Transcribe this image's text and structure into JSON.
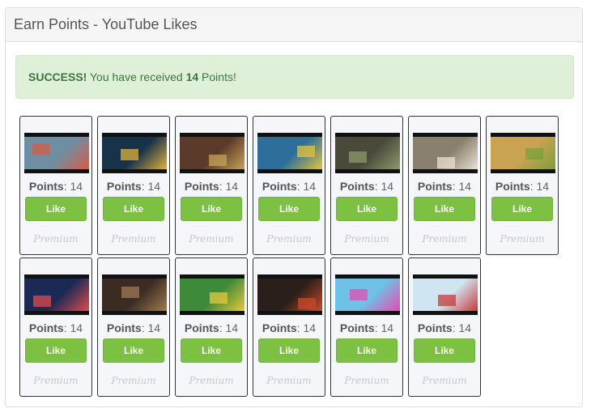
{
  "page": {
    "title": "Earn Points - YouTube Likes"
  },
  "alert": {
    "strong": "SUCCESS!",
    "text1": " You have received ",
    "amount": "14",
    "text2": " Points!"
  },
  "cards": [
    {
      "points_label": "Points",
      "points_value": ": 14",
      "like_label": "Like",
      "premium_label": "Premium",
      "thumb_bg": "#6e8fa3",
      "thumb_accent": "#d95b43"
    },
    {
      "points_label": "Points",
      "points_value": ": 14",
      "like_label": "Like",
      "premium_label": "Premium",
      "thumb_bg": "#18324a",
      "thumb_accent": "#e0b23a"
    },
    {
      "points_label": "Points",
      "points_value": ": 14",
      "like_label": "Like",
      "premium_label": "Premium",
      "thumb_bg": "#5a3a28",
      "thumb_accent": "#c8a25a"
    },
    {
      "points_label": "Points",
      "points_value": ": 14",
      "like_label": "Like",
      "premium_label": "Premium",
      "thumb_bg": "#2d6f9a",
      "thumb_accent": "#e3c43b"
    },
    {
      "points_label": "Points",
      "points_value": ": 14",
      "like_label": "Like",
      "premium_label": "Premium",
      "thumb_bg": "#4a4a3a",
      "thumb_accent": "#8a9a6a"
    },
    {
      "points_label": "Points",
      "points_value": ": 14",
      "like_label": "Like",
      "premium_label": "Premium",
      "thumb_bg": "#8a8070",
      "thumb_accent": "#e8e0d0"
    },
    {
      "points_label": "Points",
      "points_value": ": 14",
      "like_label": "Like",
      "premium_label": "Premium",
      "thumb_bg": "#c9a352",
      "thumb_accent": "#7aa03a"
    },
    {
      "points_label": "Points",
      "points_value": ": 14",
      "like_label": "Like",
      "premium_label": "Premium",
      "thumb_bg": "#1a2a55",
      "thumb_accent": "#e04a4a"
    },
    {
      "points_label": "Points",
      "points_value": ": 14",
      "like_label": "Like",
      "premium_label": "Premium",
      "thumb_bg": "#3a2c22",
      "thumb_accent": "#a07a50"
    },
    {
      "points_label": "Points",
      "points_value": ": 14",
      "like_label": "Like",
      "premium_label": "Premium",
      "thumb_bg": "#3d8a3a",
      "thumb_accent": "#e8c83a"
    },
    {
      "points_label": "Points",
      "points_value": ": 14",
      "like_label": "Like",
      "premium_label": "Premium",
      "thumb_bg": "#2a1f1a",
      "thumb_accent": "#c84a2a"
    },
    {
      "points_label": "Points",
      "points_value": ": 14",
      "like_label": "Like",
      "premium_label": "Premium",
      "thumb_bg": "#6ec2e8",
      "thumb_accent": "#e84ab0"
    },
    {
      "points_label": "Points",
      "points_value": ": 14",
      "like_label": "Like",
      "premium_label": "Premium",
      "thumb_bg": "#cfe6f2",
      "thumb_accent": "#c83a3a"
    }
  ]
}
